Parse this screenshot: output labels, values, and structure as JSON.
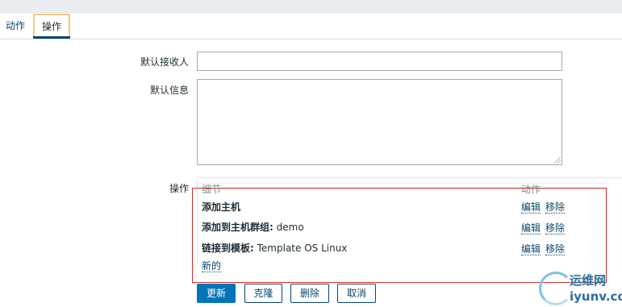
{
  "tabs": [
    {
      "label": "动作",
      "active": false
    },
    {
      "label": "操作",
      "active": true
    }
  ],
  "form": {
    "default_recipient_label": "默认接收人",
    "default_recipient_value": "",
    "default_message_label": "默认信息",
    "default_message_value": "",
    "operations_label": "操作"
  },
  "operations": {
    "col_details": "细节",
    "col_action": "动作",
    "rows": [
      {
        "title": "添加主机",
        "detail": ""
      },
      {
        "title": "添加到主机群组:",
        "detail": " demo"
      },
      {
        "title": "链接到模板:",
        "detail": " Template OS Linux"
      }
    ],
    "edit_label": "编辑",
    "remove_label": "移除",
    "new_label": "新的"
  },
  "buttons": {
    "update": "更新",
    "clone": "克隆",
    "delete": "删除",
    "cancel": "取消"
  },
  "watermark": {
    "name": "运维网",
    "url": "iyunv.com"
  },
  "colors": {
    "link": "#0a466a",
    "primary": "#0275b8",
    "tab_highlight": "#f3c77e",
    "annotation_box": "#c9302c"
  }
}
